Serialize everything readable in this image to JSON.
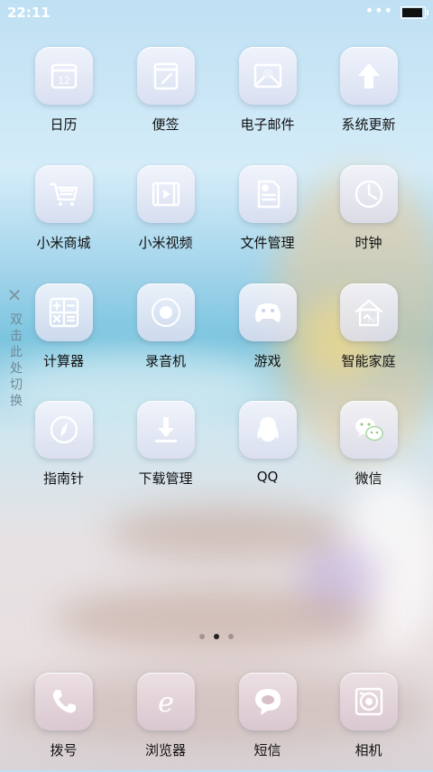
{
  "status_bar": {
    "time": "22:11",
    "signal": "•••"
  },
  "side_hint": {
    "close": "✕",
    "text": "双击此处切换"
  },
  "apps": [
    {
      "label": "日历",
      "icon": "calendar-icon",
      "date": "12"
    },
    {
      "label": "便签",
      "icon": "notes-icon"
    },
    {
      "label": "电子邮件",
      "icon": "email-icon"
    },
    {
      "label": "系统更新",
      "icon": "update-arrow-icon"
    },
    {
      "label": "小米商城",
      "icon": "shopping-cart-icon"
    },
    {
      "label": "小米视频",
      "icon": "video-icon"
    },
    {
      "label": "文件管理",
      "icon": "file-manager-icon"
    },
    {
      "label": "时钟",
      "icon": "clock-icon"
    },
    {
      "label": "计算器",
      "icon": "calculator-icon"
    },
    {
      "label": "录音机",
      "icon": "recorder-icon"
    },
    {
      "label": "游戏",
      "icon": "gamepad-icon"
    },
    {
      "label": "智能家庭",
      "icon": "smart-home-icon",
      "badge": "mi"
    },
    {
      "label": "指南针",
      "icon": "compass-icon"
    },
    {
      "label": "下载管理",
      "icon": "download-icon"
    },
    {
      "label": "QQ",
      "icon": "qq-penguin-icon"
    },
    {
      "label": "微信",
      "icon": "wechat-icon"
    }
  ],
  "pager": {
    "pages": 3,
    "current": 2
  },
  "dock": [
    {
      "label": "拨号",
      "icon": "phone-icon"
    },
    {
      "label": "浏览器",
      "icon": "browser-icon",
      "glyph": "e"
    },
    {
      "label": "短信",
      "icon": "message-icon"
    },
    {
      "label": "相机",
      "icon": "camera-icon"
    }
  ]
}
